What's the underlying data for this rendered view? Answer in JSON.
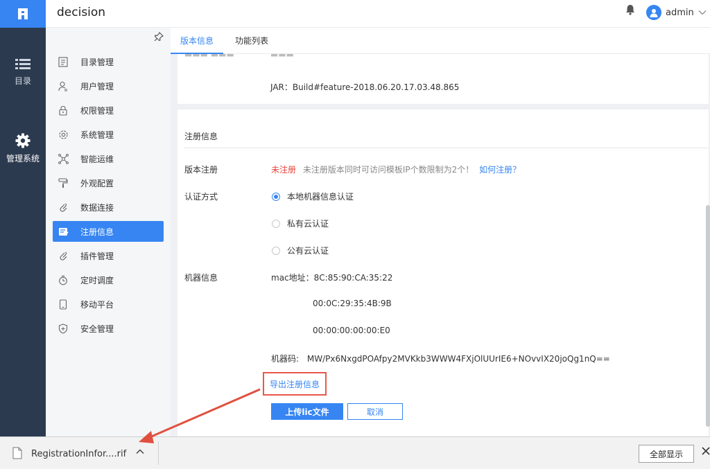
{
  "app": {
    "title": "decision"
  },
  "rail": {
    "items": [
      {
        "label": "目录"
      },
      {
        "label": "管理系统"
      }
    ]
  },
  "header": {
    "user_name": "admin"
  },
  "sidebar": {
    "items": [
      {
        "label": "目录管理",
        "icon": "catalog-icon"
      },
      {
        "label": "用户管理",
        "icon": "user-icon"
      },
      {
        "label": "权限管理",
        "icon": "lock-icon"
      },
      {
        "label": "系统管理",
        "icon": "gear-icon"
      },
      {
        "label": "智能运维",
        "icon": "network-icon"
      },
      {
        "label": "外观配置",
        "icon": "paint-roller-icon"
      },
      {
        "label": "数据连接",
        "icon": "link-icon"
      },
      {
        "label": "注册信息",
        "icon": "registration-icon",
        "active": true
      },
      {
        "label": "插件管理",
        "icon": "plugin-icon"
      },
      {
        "label": "定时调度",
        "icon": "timer-icon"
      },
      {
        "label": "移动平台",
        "icon": "mobile-icon"
      },
      {
        "label": "安全管理",
        "icon": "shield-icon"
      }
    ]
  },
  "tabs": [
    {
      "label": "版本信息",
      "active": true
    },
    {
      "label": "功能列表",
      "active": false
    }
  ],
  "version": {
    "jar_line": "JAR：Build#feature-2018.06.20.17.03.48.865"
  },
  "registration": {
    "section_title": "注册信息",
    "version_label": "版本注册",
    "status": "未注册",
    "notice": "未注册版本同时可访问模板IP个数限制为2个！",
    "how_link": "如何注册？",
    "auth_label": "认证方式",
    "auth_options": [
      {
        "label": "本地机器信息认证",
        "selected": true
      },
      {
        "label": "私有云认证",
        "selected": false
      },
      {
        "label": "公有云认证",
        "selected": false
      }
    ],
    "machine_label": "机器信息",
    "mac_prefix": "mac地址：",
    "macs": [
      "8C:85:90:CA:35:22",
      "00:0C:29:35:4B:9B",
      "00:00:00:00:00:E0"
    ],
    "code_label": "机器码:",
    "code_value": "MW/Px6NxgdPOAfpy2MVKkb3WWW4FXjOlUUrIE6+NOvvIX20joQg1nQ==",
    "export_label": "导出注册信息",
    "upload_label": "上传lic文件",
    "cancel_label": "取消"
  },
  "download_bar": {
    "file_name": "RegistrationInfor....rif",
    "show_all_label": "全部显示"
  },
  "colors": {
    "accent": "#3685f2",
    "rail_bg": "#2c3a4f",
    "status_red": "#e8453c",
    "highlight_box": "#e8574a"
  }
}
